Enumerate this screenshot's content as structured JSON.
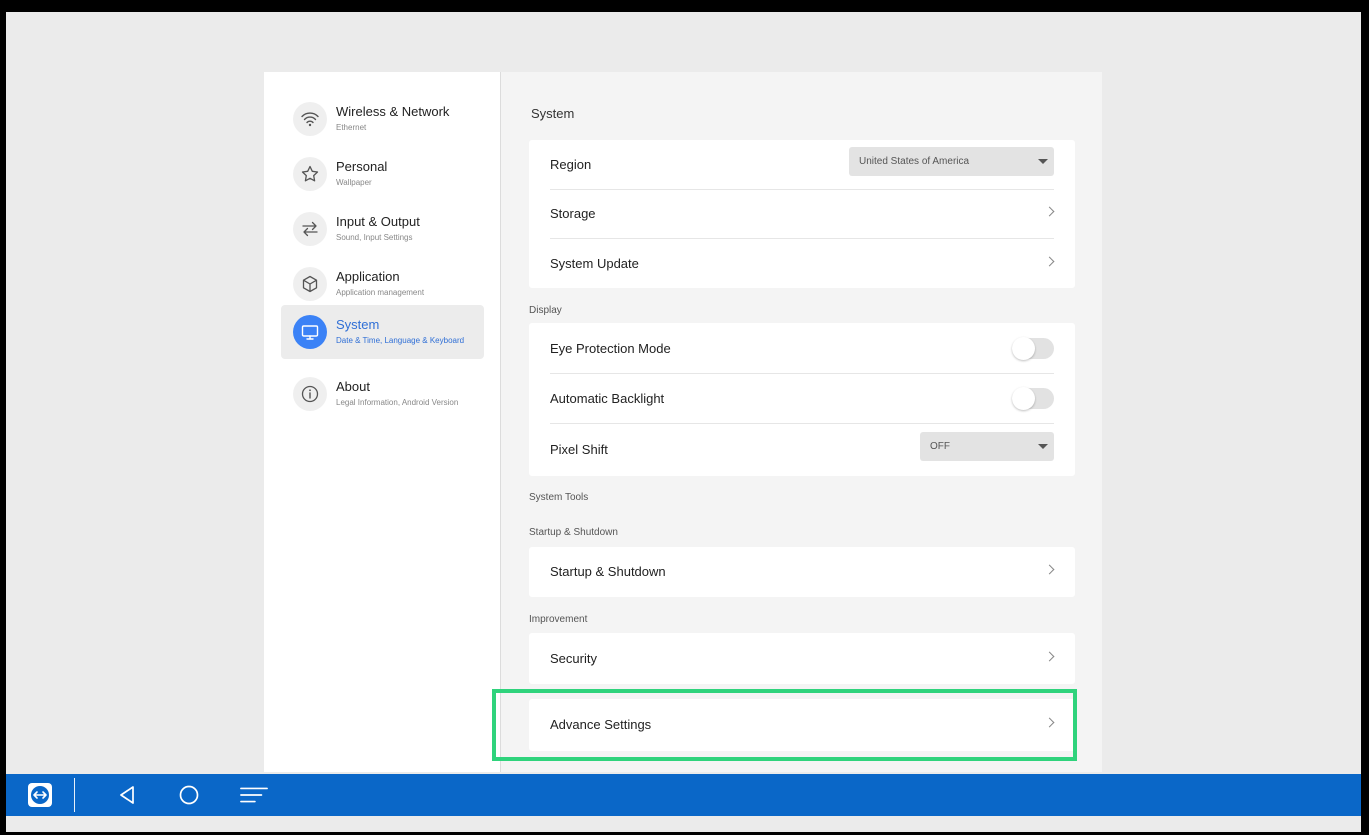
{
  "sidebar": {
    "items": [
      {
        "title": "Wireless & Network",
        "sub": "Ethernet",
        "icon": "wifi-icon"
      },
      {
        "title": "Personal",
        "sub": "Wallpaper",
        "icon": "star-icon"
      },
      {
        "title": "Input & Output",
        "sub": "Sound, Input Settings",
        "icon": "swap-arrows-icon"
      },
      {
        "title": "Application",
        "sub": "Application management",
        "icon": "cube-icon"
      },
      {
        "title": "System",
        "sub": "Date & Time, Language & Keyboard",
        "icon": "monitor-icon",
        "active": true
      },
      {
        "title": "About",
        "sub": "Legal Information, Android Version",
        "icon": "info-icon"
      }
    ]
  },
  "content": {
    "page_title": "System",
    "system_rows": {
      "region_label": "Region",
      "region_value": "United States of America",
      "storage_label": "Storage",
      "update_label": "System Update"
    },
    "display": {
      "section": "Display",
      "eye_label": "Eye Protection Mode",
      "eye_on": false,
      "backlight_label": "Automatic Backlight",
      "backlight_on": false,
      "pixel_label": "Pixel Shift",
      "pixel_value": "OFF"
    },
    "system_tools": {
      "section": "System Tools"
    },
    "startup": {
      "section": "Startup & Shutdown",
      "row_label": "Startup & Shutdown"
    },
    "improvement": {
      "section": "Improvement",
      "security_label": "Security"
    },
    "advance": {
      "row_label": "Advance Settings"
    }
  },
  "colors": {
    "accent": "#3b82f6",
    "highlight": "#2fd37c",
    "taskbar": "#0a67c8"
  },
  "taskbar": {
    "icons": [
      "teamviewer-icon",
      "back-icon",
      "home-icon",
      "menu-icon"
    ]
  }
}
